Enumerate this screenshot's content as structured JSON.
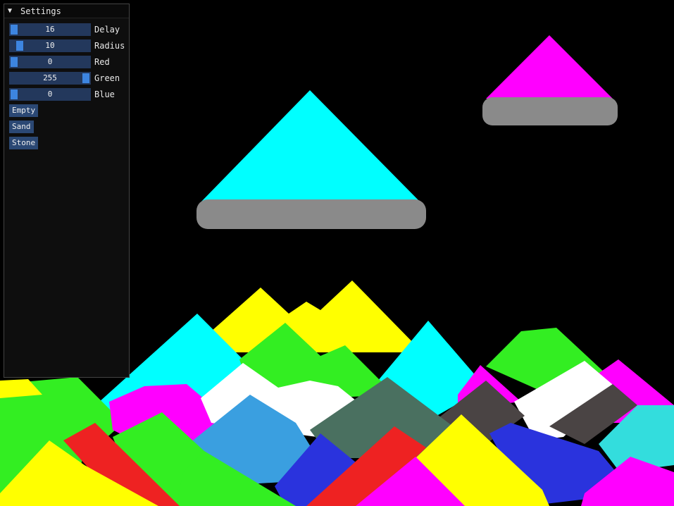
{
  "window": {
    "title": "Settings",
    "collapse_icon": "triangle-down-icon"
  },
  "sliders": [
    {
      "label": "Delay",
      "value": "16",
      "level": 0.0
    },
    {
      "label": "Radius",
      "value": "10",
      "level": 0.08
    },
    {
      "label": "Red",
      "value": "0",
      "level": 0.0
    },
    {
      "label": "Green",
      "value": "255",
      "level": 1.0
    },
    {
      "label": "Blue",
      "value": "0",
      "level": 0.0
    }
  ],
  "buttons": {
    "empty": "Empty",
    "sand": "Sand",
    "stone": "Stone"
  },
  "colors": {
    "background": "#000000",
    "slider_frame": "#23385c",
    "slider_grab": "#3d85e0",
    "button": "#2b4874",
    "stone": "#8a8a8a",
    "sand_cyan": "#00ffff",
    "sand_magenta": "#ff00ff",
    "sand_yellow": "#ffff00",
    "sand_green": "#33ee22",
    "sand_white": "#ffffff",
    "sand_red": "#ee2222",
    "sand_blue": "#2a33dd",
    "sand_lightblue": "#3a9fe0",
    "sand_darkgreen": "#4a7060",
    "sand_darkgray": "#4a4444"
  }
}
